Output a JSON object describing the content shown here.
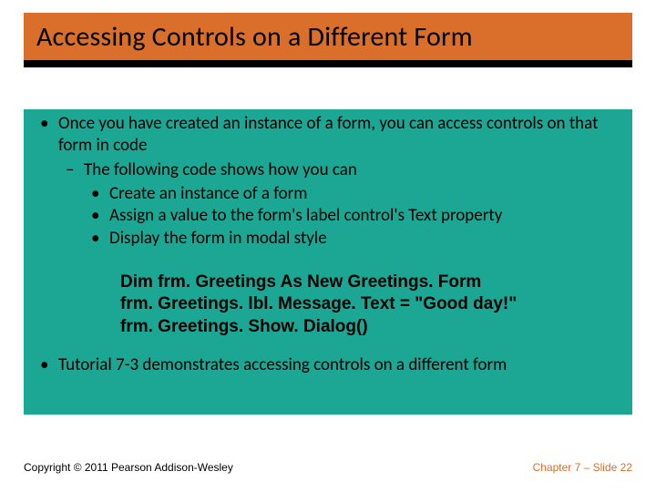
{
  "title": "Accessing Controls on a Different Form",
  "bullets": {
    "b1": "Once you have created an instance of a form, you can access controls on that form in code",
    "b1_1": "The following code shows how you can",
    "b1_1_1": "Create an instance of a form",
    "b1_1_2": "Assign a value to the form's label control's Text property",
    "b1_1_3": "Display the form in modal style",
    "b2": "Tutorial 7-3 demonstrates accessing controls on a different form"
  },
  "code": {
    "line1": "Dim frm. Greetings As New Greetings. Form",
    "line2": "frm. Greetings. lbl. Message. Text = \"Good day!\"",
    "line3": "frm. Greetings. Show. Dialog()"
  },
  "footer": {
    "copyright": "Copyright © 2011 Pearson Addison-Wesley",
    "page": "Chapter 7 – Slide 22"
  }
}
